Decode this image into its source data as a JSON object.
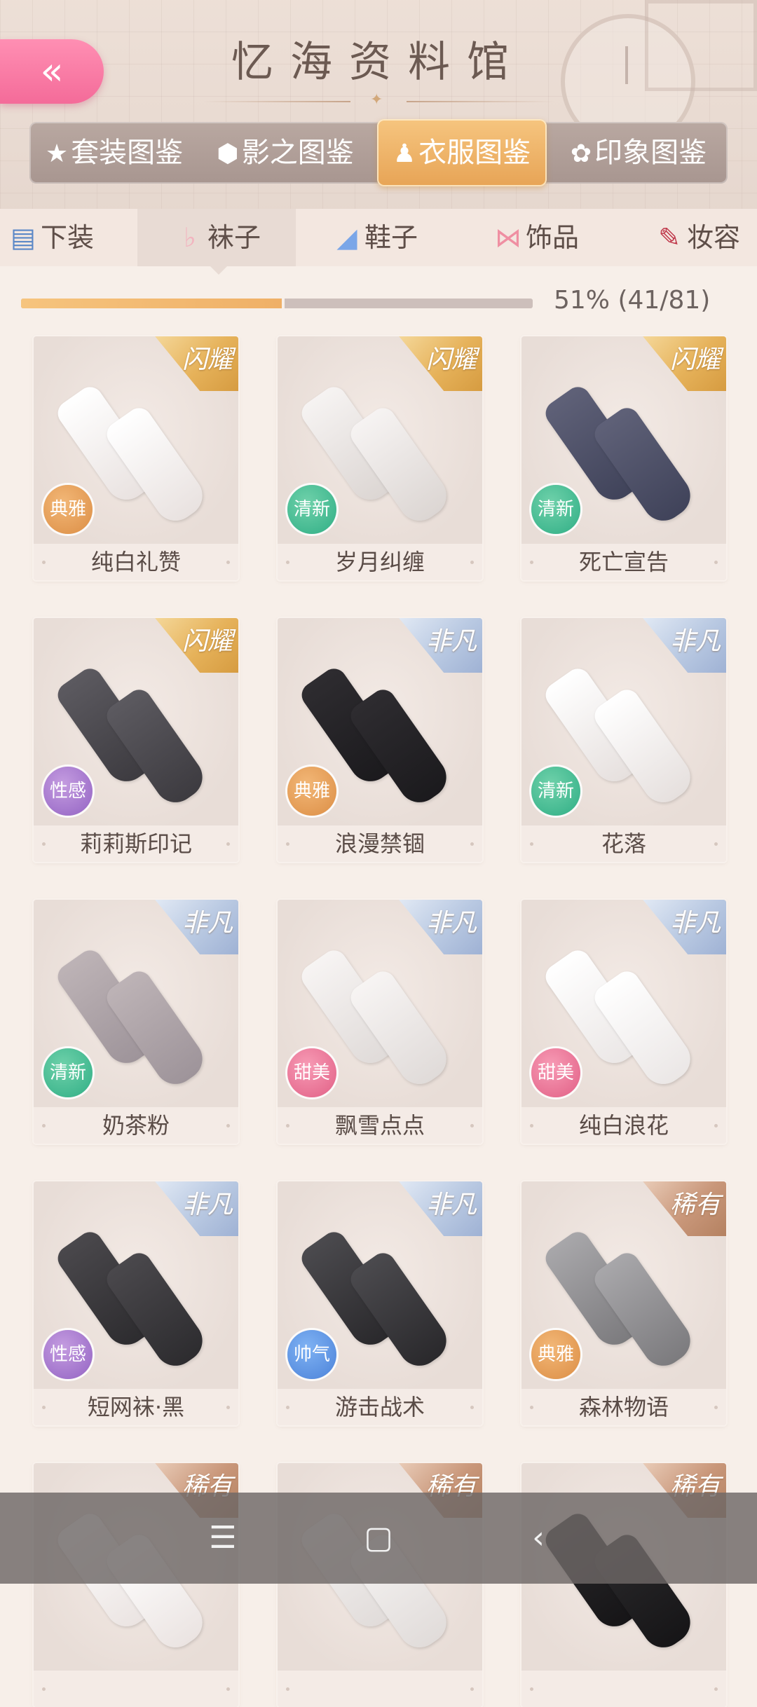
{
  "header": {
    "title": "忆海资料馆",
    "back_icon": "double-chevron-left-icon",
    "categories": [
      {
        "label": "套装图鉴",
        "icon": "star-icon",
        "active": false
      },
      {
        "label": "影之图鉴",
        "icon": "gem-icon",
        "active": false
      },
      {
        "label": "衣服图鉴",
        "icon": "dress-icon",
        "active": true
      },
      {
        "label": "印象图鉴",
        "icon": "flower-icon",
        "active": false
      }
    ]
  },
  "subtabs": [
    {
      "label": "下装",
      "icon": "jeans-icon",
      "active": false
    },
    {
      "label": "袜子",
      "icon": "sock-icon",
      "active": true
    },
    {
      "label": "鞋子",
      "icon": "shoe-icon",
      "active": false
    },
    {
      "label": "饰品",
      "icon": "bow-icon",
      "active": false
    },
    {
      "label": "妆容",
      "icon": "brush-icon",
      "active": false
    }
  ],
  "progress": {
    "text": "51% (41/81)",
    "fraction": 0.51
  },
  "items": [
    {
      "name": "纯白礼赞",
      "rarity": "闪耀",
      "tier": "gold",
      "style": "典雅",
      "style_key": "elegant"
    },
    {
      "name": "岁月纠缠",
      "rarity": "闪耀",
      "tier": "gold",
      "style": "清新",
      "style_key": "fresh"
    },
    {
      "name": "死亡宣告",
      "rarity": "闪耀",
      "tier": "gold",
      "style": "清新",
      "style_key": "fresh"
    },
    {
      "name": "莉莉斯印记",
      "rarity": "闪耀",
      "tier": "gold",
      "style": "性感",
      "style_key": "sexy"
    },
    {
      "name": "浪漫禁锢",
      "rarity": "非凡",
      "tier": "blue",
      "style": "典雅",
      "style_key": "elegant"
    },
    {
      "name": "花落",
      "rarity": "非凡",
      "tier": "blue",
      "style": "清新",
      "style_key": "fresh"
    },
    {
      "name": "奶茶粉",
      "rarity": "非凡",
      "tier": "blue",
      "style": "清新",
      "style_key": "fresh"
    },
    {
      "name": "飘雪点点",
      "rarity": "非凡",
      "tier": "blue",
      "style": "甜美",
      "style_key": "sweet"
    },
    {
      "name": "纯白浪花",
      "rarity": "非凡",
      "tier": "blue",
      "style": "甜美",
      "style_key": "sweet"
    },
    {
      "name": "短网袜·黑",
      "rarity": "非凡",
      "tier": "blue",
      "style": "性感",
      "style_key": "sexy"
    },
    {
      "name": "游击战术",
      "rarity": "非凡",
      "tier": "blue",
      "style": "帅气",
      "style_key": "cool"
    },
    {
      "name": "森林物语",
      "rarity": "稀有",
      "tier": "bronze",
      "style": "典雅",
      "style_key": "elegant"
    },
    {
      "name": "",
      "rarity": "稀有",
      "tier": "bronze",
      "style": "",
      "style_key": ""
    },
    {
      "name": "",
      "rarity": "稀有",
      "tier": "bronze",
      "style": "",
      "style_key": ""
    },
    {
      "name": "",
      "rarity": "稀有",
      "tier": "bronze",
      "style": "",
      "style_key": ""
    }
  ],
  "colors": {
    "accent_pink": "#f46b99",
    "active_gold": "#e7a456",
    "progress_fill": "#f6c47e"
  },
  "navbar": {
    "menu_icon": "menu-icon",
    "home_icon": "home-square-icon",
    "back_icon": "chevron-left-icon"
  }
}
